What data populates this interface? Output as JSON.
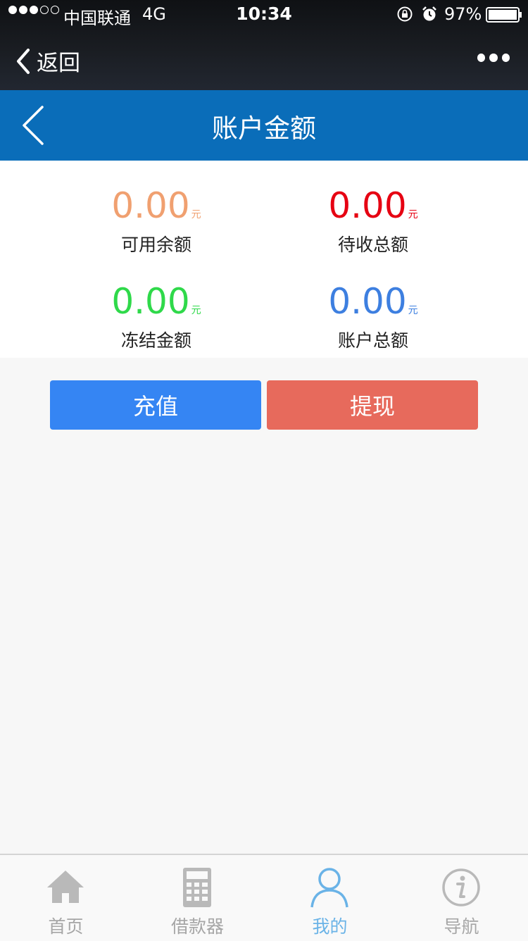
{
  "status_bar": {
    "carrier": "中国联通",
    "network": "4G",
    "time": "10:34",
    "battery": "97%",
    "signal_bars_filled": 3,
    "signal_bars_total": 5
  },
  "wechat_nav": {
    "back_label": "返回"
  },
  "header": {
    "title": "账户金额"
  },
  "amounts": [
    {
      "value": "0.00",
      "unit": "元",
      "label": "可用余额",
      "color": "#f0a070"
    },
    {
      "value": "0.00",
      "unit": "元",
      "label": "待收总额",
      "color": "#e60012"
    },
    {
      "value": "0.00",
      "unit": "元",
      "label": "冻结金额",
      "color": "#2fd94a"
    },
    {
      "value": "0.00",
      "unit": "元",
      "label": "账户总额",
      "color": "#3d7fe0"
    }
  ],
  "actions": {
    "recharge": "充值",
    "withdraw": "提现"
  },
  "tabbar": {
    "items": [
      {
        "label": "首页",
        "icon": "home-icon",
        "active": false
      },
      {
        "label": "借款器",
        "icon": "calculator-icon",
        "active": false
      },
      {
        "label": "我的",
        "icon": "user-icon",
        "active": true
      },
      {
        "label": "导航",
        "icon": "info-icon",
        "active": false
      }
    ]
  },
  "colors": {
    "header_blue": "#0a6db9",
    "recharge_button": "#3585f3",
    "withdraw_button": "#e76a5c",
    "tab_active": "#6ab3e7",
    "tab_inactive": "#a6a6a6"
  }
}
